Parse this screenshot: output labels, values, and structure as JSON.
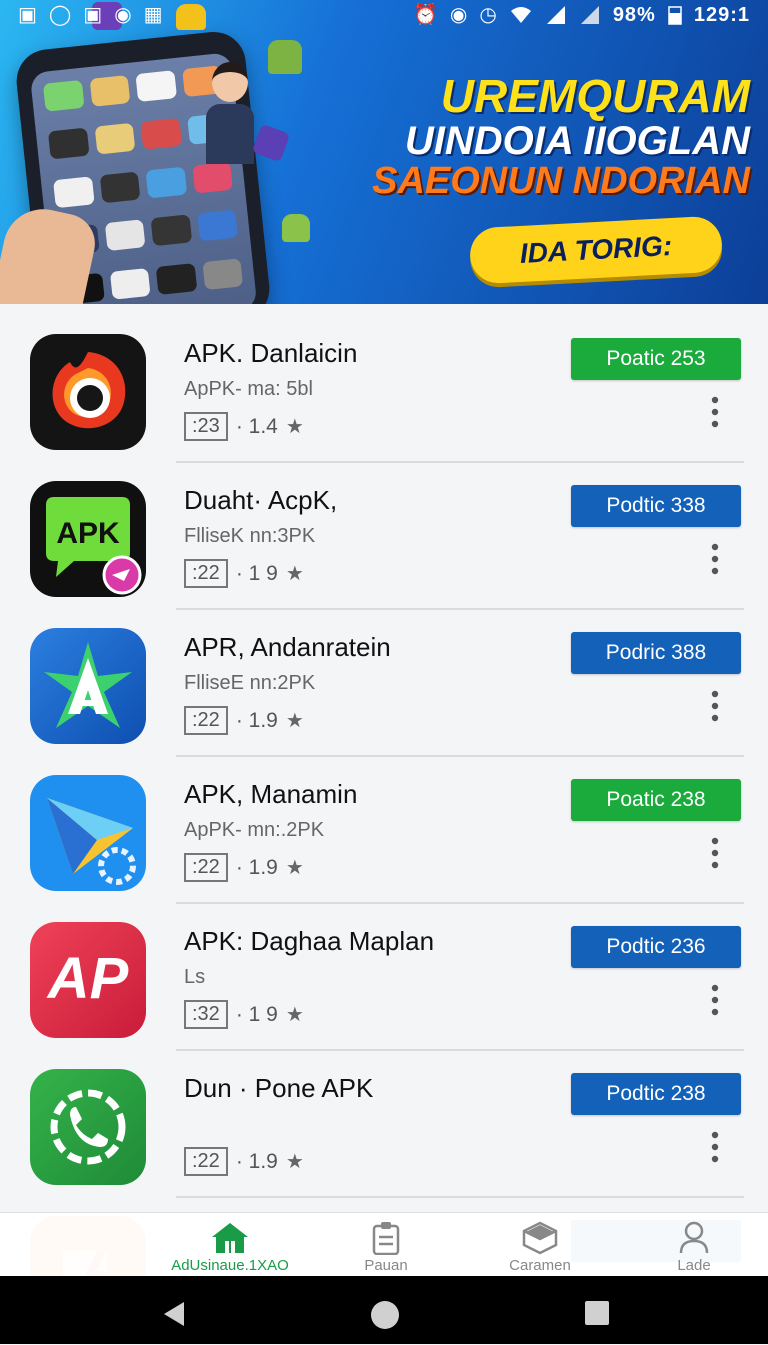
{
  "status_bar": {
    "battery": "98%",
    "time": "129:1",
    "left_icons": [
      "notification-icon",
      "circle-icon",
      "app-icon",
      "android-icon",
      "image-icon"
    ],
    "right_icons": [
      "alarm-icon",
      "location-icon",
      "timer-icon",
      "wifi-icon",
      "signal-icon",
      "signal-icon",
      "battery-icon"
    ]
  },
  "banner": {
    "headline_line1": "UREMQURAM",
    "headline_line2": "UINDOIA IIOGLAN",
    "headline_line3": "SAEONUN NDORIAN",
    "cta_label": "IDA TORIG:"
  },
  "apps": [
    {
      "title": "APK. Danlaicin",
      "subtitle": "ApPK- ma: 5bl",
      "size": ":23",
      "rating": "· 1.4",
      "button_label": "Poatic 253",
      "button_color": "#1aab3c",
      "icon": "red-camera-icon"
    },
    {
      "title": "Duaht· AcpK,",
      "subtitle": "FlliseK nn:3PK",
      "size": ":22",
      "rating": "· 1 9",
      "button_label": "Podtic 338",
      "button_color": "#1361b8",
      "icon": "apk-chat-icon"
    },
    {
      "title": "APR, Andanratein",
      "subtitle": "FlliseE nn:2PK",
      "size": ":22",
      "rating": "· 1.9",
      "button_label": "Podric 388",
      "button_color": "#1361b8",
      "icon": "blue-star-icon"
    },
    {
      "title": "APK, Manamin",
      "subtitle": "ApPK- mn:.2PK",
      "size": ":22",
      "rating": "· 1.9",
      "button_label": "Poatic 238",
      "button_color": "#1aab3c",
      "icon": "paper-plane-icon"
    },
    {
      "title": "APK: Daghaa Maplan",
      "subtitle": "Ls",
      "size": ":32",
      "rating": "· 1 9",
      "button_label": "Podtic 236",
      "button_color": "#1361b8",
      "icon": "red-ap-icon"
    },
    {
      "title": "Dun · Pone APK",
      "subtitle": "",
      "size": ":22",
      "rating": "· 1.9",
      "button_label": "Podtic 238",
      "button_color": "#1361b8",
      "icon": "green-phone-icon"
    }
  ],
  "bottom_nav": [
    {
      "label": "AdUsinaue.1XAO",
      "icon": "home-icon",
      "active": true
    },
    {
      "label": "Pauan",
      "icon": "clipboard-icon",
      "active": false
    },
    {
      "label": "Caramen",
      "icon": "cube-icon",
      "active": false
    },
    {
      "label": "Lade",
      "icon": "person-icon",
      "active": false
    }
  ]
}
